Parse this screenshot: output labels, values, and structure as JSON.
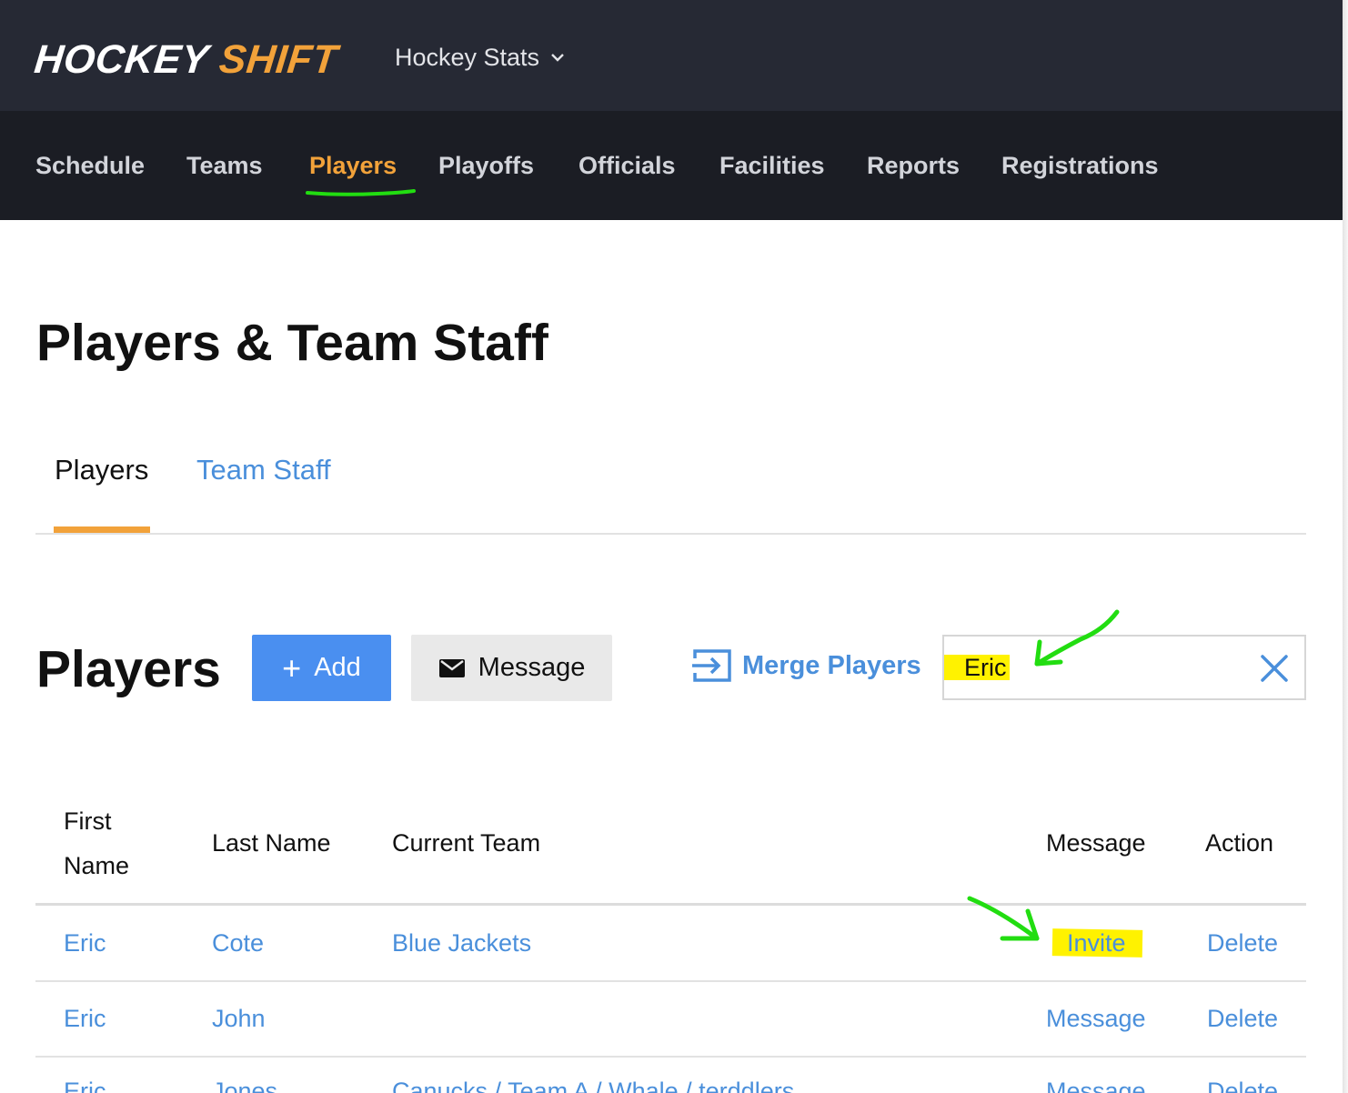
{
  "app": {
    "logo_part1": "HOCKEY",
    "logo_part2": "SHIFT",
    "org_selector": "Hockey Stats"
  },
  "nav": {
    "items": [
      "Schedule",
      "Teams",
      "Players",
      "Playoffs",
      "Officials",
      "Facilities",
      "Reports",
      "Registrations"
    ],
    "active": "Players"
  },
  "page": {
    "title": "Players & Team Staff"
  },
  "tabs": {
    "players": "Players",
    "team_staff": "Team Staff"
  },
  "section": {
    "title": "Players",
    "add_label": "Add",
    "message_label": "Message",
    "merge_label": "Merge Players"
  },
  "search": {
    "value": "Eric"
  },
  "table": {
    "headers": {
      "first_line1": "First",
      "first_line2": "Name",
      "last": "Last Name",
      "team": "Current Team",
      "message": "Message",
      "action": "Action"
    },
    "rows": [
      {
        "first": "Eric",
        "last": "Cote",
        "team": "Blue Jackets",
        "message": "Invite",
        "action": "Delete"
      },
      {
        "first": "Eric",
        "last": "John",
        "team": "",
        "message": "Message",
        "action": "Delete"
      },
      {
        "first": "Eric",
        "last": "Jones",
        "team": "Canucks / Team A / Whale / terddlers",
        "message": "Message",
        "action": "Delete"
      }
    ]
  },
  "colors": {
    "accent_orange": "#f2a23a",
    "link_blue": "#4a8fdb",
    "add_button": "#4a8ff0",
    "topbar": "#262934",
    "navbar": "#1b1d24",
    "highlight_yellow": "#fff200",
    "annotation_green": "#22dd11"
  }
}
